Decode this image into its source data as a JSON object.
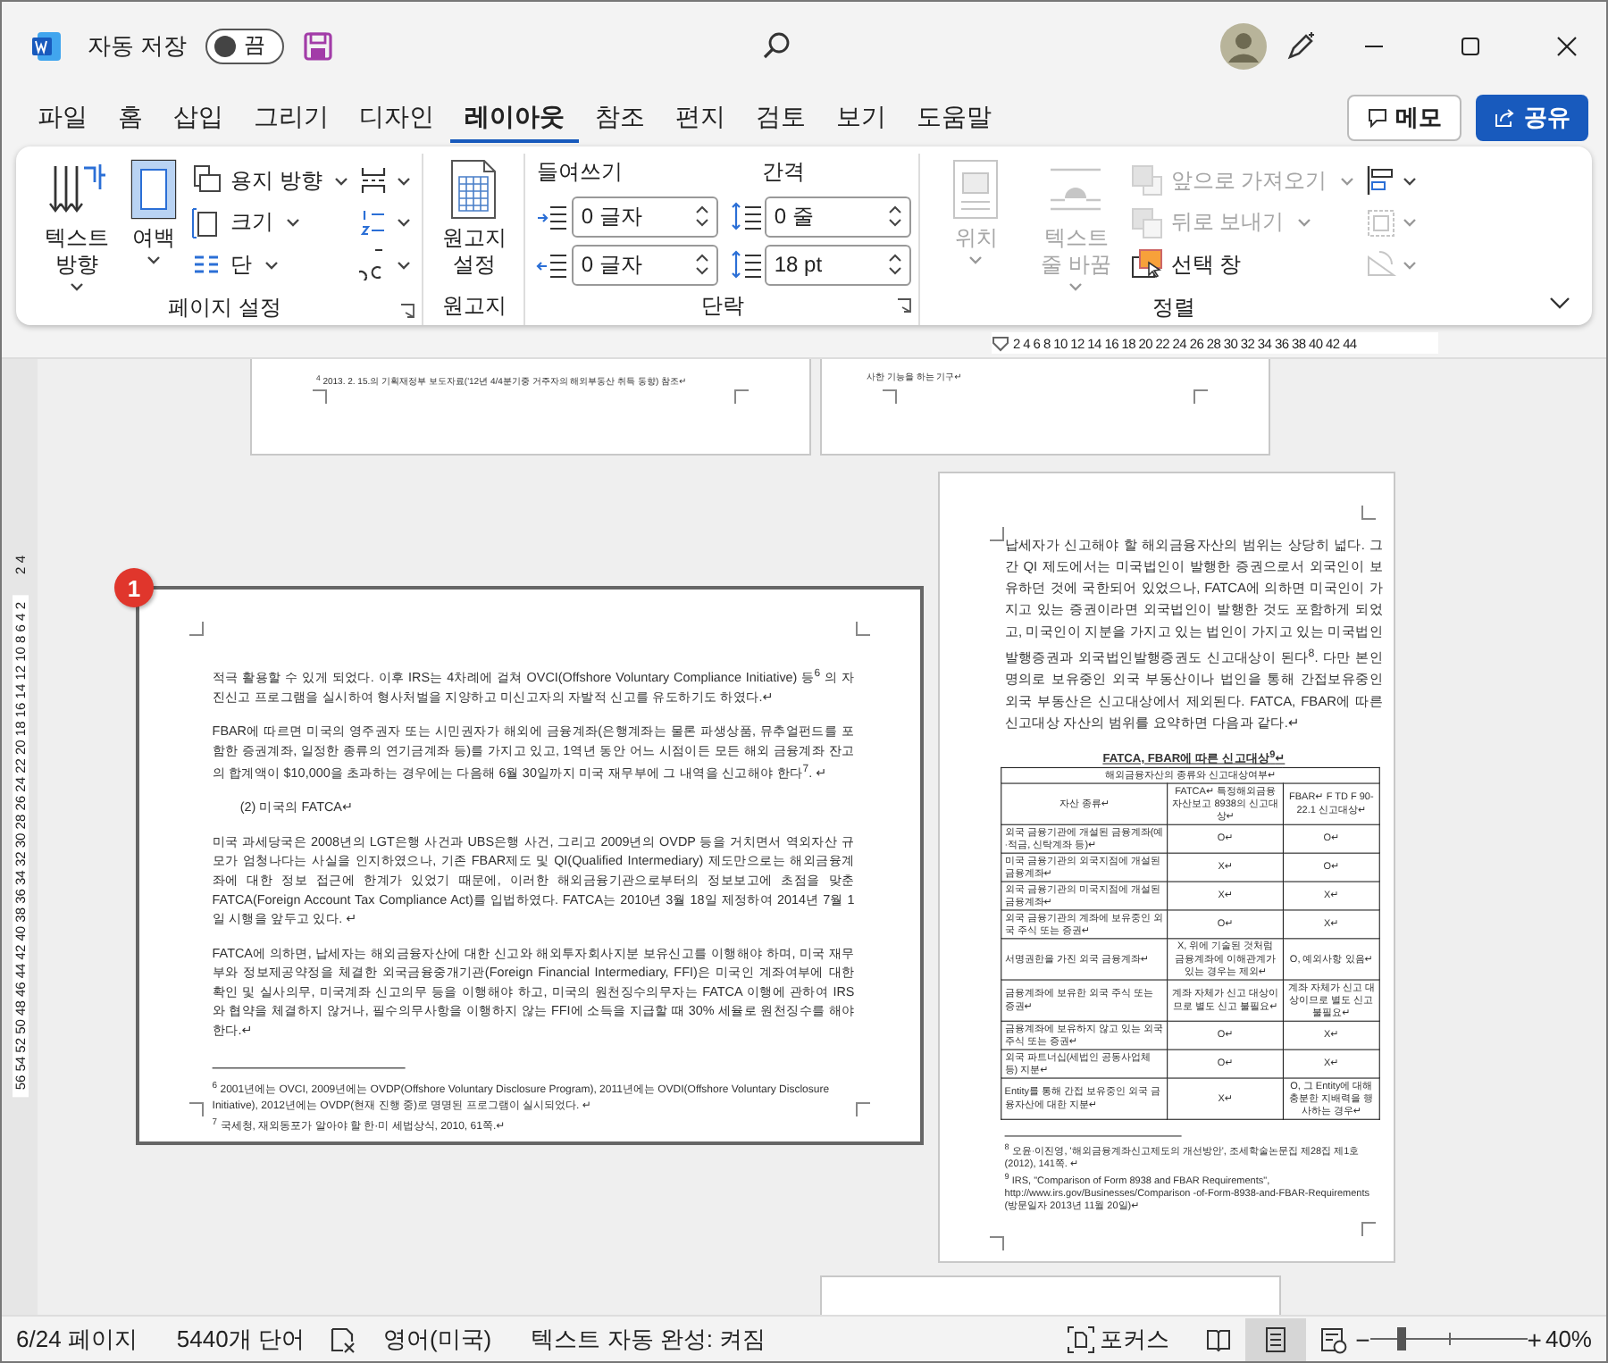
{
  "title_bar": {
    "autosave_label": "자동 저장",
    "autosave": {
      "on": false,
      "label": "끔"
    }
  },
  "tabs": [
    {
      "label": "파일",
      "selected": false
    },
    {
      "label": "홈",
      "selected": false
    },
    {
      "label": "삽입",
      "selected": false
    },
    {
      "label": "그리기",
      "selected": false
    },
    {
      "label": "디자인",
      "selected": false
    },
    {
      "label": "레이아웃",
      "selected": true
    },
    {
      "label": "참조",
      "selected": false
    },
    {
      "label": "편지",
      "selected": false
    },
    {
      "label": "검토",
      "selected": false
    },
    {
      "label": "보기",
      "selected": false
    },
    {
      "label": "도움말",
      "selected": false
    }
  ],
  "comment_button": "메모",
  "share_button": "공유",
  "ribbon": {
    "page_setup": {
      "label": "페이지 설정",
      "text_direction": "텍스트 방향",
      "margins": "여백",
      "orientation": "용지 방향",
      "size": "크기",
      "columns": "단"
    },
    "manuscript": {
      "label": "원고지",
      "settings": "원고지 설정"
    },
    "paragraph": {
      "label": "단락",
      "indent_label": "들여쓰기",
      "spacing_label": "간격",
      "indent_left": "0 글자",
      "indent_right": "0 글자",
      "spacing_before": "0 줄",
      "spacing_after": "18 pt"
    },
    "arrange": {
      "label": "정렬",
      "items": [
        {
          "label": "위치",
          "disabled": true
        },
        {
          "label": "텍스트 줄 바꿈",
          "disabled": true
        },
        {
          "label": "앞으로 가져오기",
          "disabled": true
        },
        {
          "label": "뒤로 보내기",
          "disabled": true
        },
        {
          "label": "선택 창",
          "disabled": false
        }
      ],
      "tools": [
        {
          "disabled": false
        },
        {
          "disabled": true
        },
        {
          "disabled": true
        }
      ]
    }
  },
  "ruler": {
    "horizontal": "2 4 6 8 10 12 14 16 18 20 22 24 26 28 30 32 34 36 38 40 42 44",
    "vertical_top": "2 4",
    "vertical": "56 54 52 50 48 46 44 42 40 38 36 34 32 30 28 26 24 22 20 18 16 14 12 10 8 6 4 2"
  },
  "pages": [
    {
      "kind": "partial",
      "selected": false,
      "blocks": [
        {
          "kind": "footnote",
          "text": "$^{4}$ 2013. 2. 15.의 기획재정부 보도자료('12년 4/4분기중 거주자의 해외부동산 취득 동향) 참조↵"
        }
      ]
    },
    {
      "kind": "partial",
      "selected": false,
      "blocks": [
        {
          "kind": "footnote",
          "text": "사한 기능을 하는 기구↵"
        }
      ]
    },
    {
      "kind": "left",
      "selected": true,
      "callout": "1",
      "blocks": [
        {
          "kind": "para",
          "text": "적극 활용할 수 있게 되었다. 이후 IRS는 4차례에 걸쳐 OVCI(Offshore Voluntary Compliance Initiative) 등$^{6}$ 의 자진신고 프로그램을 실시하여 형사처벌을 지양하고 미신고자의 자발적 신고를 유도하기도 하였다.↵"
        },
        {
          "kind": "para",
          "text": "FBAR에 따르면 미국의 영주권자 또는 시민권자가 해외에 금융계좌(은행계좌는 물론 파생상품, 뮤추얼펀드를 포함한 증권계좌, 일정한 종류의 연기금계좌 등)를 가지고 있고, 1역년 동안 어느 시점이든 모든 해외 금융계좌 잔고의 합계액이 $10,000을 초과하는 경우에는 다음해 6월 30일까지 미국 재무부에 그 내역을 신고해야 한다$^{7}$. ↵"
        },
        {
          "kind": "heading",
          "text": "(2) 미국의 FATCA↵"
        },
        {
          "kind": "para",
          "text": "미국 과세당국은 2008년의 LGT은행 사건과 UBS은행 사건, 그리고 2009년의 OVDP 등을 거치면서 역외자산 규모가 엄청나다는 사실을 인지하였으나, 기존 FBAR제도 및 QI(Qualified Intermediary) 제도만으로는 해외금융계좌에 대한 정보 접근에 한계가 있었기 때문에, 이러한 해외금융기관으로부터의 정보보고에 초점을 맞춘 FATCA(Foreign Account Tax Compliance Act)를 입법하였다. FATCA는 2010년 3월 18일 제정하여 2014년 7월 1일 시행을 앞두고 있다. ↵"
        },
        {
          "kind": "para",
          "text": "FATCA에 의하면, 납세자는 해외금융자산에 대한 신고와 해외투자회사지분 보유신고를 이행해야 하며, 미국 재무부와 정보제공약정을 체결한 외국금융중개기관(Foreign Financial Intermediary, FFI)은 미국인 계좌여부에 대한 확인 및 실사의무, 미국계좌 신고의무 등을 이행해야 하고, 미국의 원천징수의무자는 FATCA 이행에 관하여 IRS와 협약을 체결하지 않거나, 필수의무사항을 이행하지 않는 FFI에 소득을 지급할 때 30% 세율로 원천징수를 해야 한다.↵"
        },
        {
          "kind": "rule"
        },
        {
          "kind": "footnote",
          "text": "$^{6}$ 2001년에는 OVCI, 2009년에는 OVDP(Offshore Voluntary Disclosure Program), 2011년에는 OVDI(Offshore Voluntary Disclosure Initiative), 2012년에는 OVDP(현재 진행 중)로 명명된 프로그램이 실시되었다. ↵"
        },
        {
          "kind": "footnote",
          "text": "$^{7}$ 국세청, 재외동포가 알아야 할 한·미 세법상식, 2010, 61쪽.↵"
        }
      ]
    },
    {
      "kind": "right",
      "selected": false,
      "blocks": [
        {
          "kind": "para",
          "text": "납세자가 신고해야 할 해외금융자산의 범위는 상당히 넓다. 그간 QI 제도에서는 미국법인이 발행한 증권으로서 외국인이 보유하던 것에 국한되어 있었으나, FATCA에 의하면 미국인이 가지고 있는 증권이라면 외국법인이 발행한 것도 포함하게 되었고, 미국인이 지분을 가지고 있는 법인이 가지고 있는 미국법인발행증권과 외국법인발행증권도 신고대상이 된다$^{8}$. 다만 본인 명의로 보유중인 외국 부동산이나 법인을 통해 간접보유중인 외국 부동산은 신고대상에서 제외된다. FATCA, FBAR에 따른 신고대상 자산의 범위를 요약하면 다음과 같다.↵"
        },
        {
          "kind": "title",
          "text": "FATCA, FBAR에 따른 신고대상$^{9}$↵"
        },
        {
          "kind": "table",
          "caption": "해외금융자산의 종류와 신고대상여부↵",
          "columns": [
            "자산 종류↵",
            "FATCA↵ 특정해외금융자산보고 8938의 신고대상↵",
            "FBAR↵ F TD F 90-22.1 신고대상↵"
          ],
          "rows": [
            [
              "외국 금융기관에 개설된 금융계좌(예·적금, 신탁계좌 등)↵",
              "O↵",
              "O↵"
            ],
            [
              "미국 금융기관의 외국지점에 개설된 금융계좌↵",
              "X↵",
              "O↵"
            ],
            [
              "외국 금융기관의 미국지점에 개설된 금융계좌↵",
              "X↵",
              "X↵"
            ],
            [
              "외국 금융기관의 계좌에 보유중인 외국 주식 또는 증권↵",
              "O↵",
              "X↵"
            ],
            [
              "서명권한을 가진 외국 금융계좌↵",
              "X, 위에 기술된 것처럼 금융계좌에 이해관계가 있는 경우는 제외↵",
              "O, 예외사항 있음↵"
            ],
            [
              "금융계좌에 보유한 외국 주식 또는 증권↵",
              "계좌 자체가 신고 대상이므로 별도 신고 불필요↵",
              "계좌 자체가 신고 대상이므로 별도 신고 불필요↵"
            ],
            [
              "금융계좌에 보유하지 않고 있는 외국 주식 또는 증권↵",
              "O↵",
              "X↵"
            ],
            [
              "외국 파트너십(세법인 공동사업체 등) 지분↵",
              "O↵",
              "X↵"
            ],
            [
              "Entity를 통해 간접 보유중인 외국 금융자산에 대한 지분↵",
              "X↵",
              "O, 그 Entity에 대해 충분한 지배력을 행사하는 경우↵"
            ]
          ]
        },
        {
          "kind": "rule"
        },
        {
          "kind": "footnote",
          "text": "$^{8}$ 오윤·이진영, '해외금융계좌신고제도의 개선방안', 조세학술논문집 제28집 제1호(2012), 141쪽. ↵"
        },
        {
          "kind": "footnote",
          "text": "$^{9}$ IRS, \"Comparison of Form 8938 and FBAR Requirements\", http://www.irs.gov/Businesses/Comparison -of-Form-8938-and-FBAR-Requirements (방문일자 2013년 11월 20일)↵"
        }
      ]
    },
    {
      "kind": "blank",
      "selected": false
    }
  ],
  "status_bar": {
    "page": "6/24 페이지",
    "words": "5440개 단어",
    "language": "영어(미국)",
    "autocomplete": "텍스트 자동 완성: 켜짐",
    "focus": "포커스",
    "views": [
      {
        "selected": false
      },
      {
        "selected": true
      },
      {
        "selected": false
      }
    ],
    "zoom": {
      "level": 0.17,
      "minus": "−",
      "plus": "+",
      "reading": "40%"
    }
  }
}
